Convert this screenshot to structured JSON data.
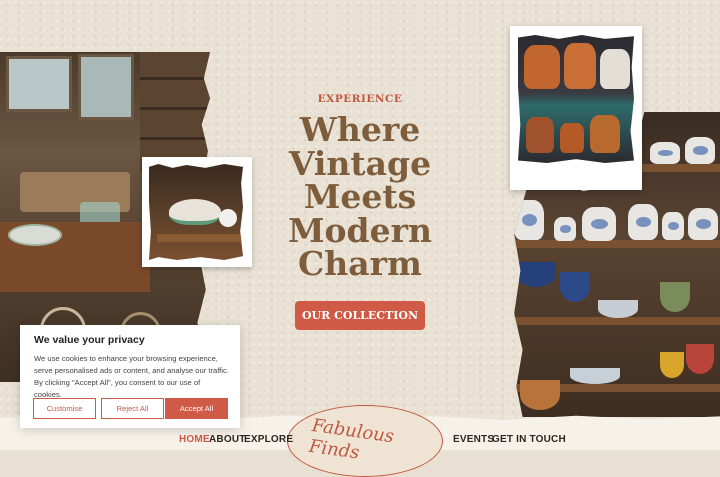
{
  "hero": {
    "eyebrow": "EXPERIENCE",
    "headline_lines": [
      "Where",
      "Vintage",
      "Meets",
      "Modern",
      "Charm"
    ],
    "cta_label": "OUR COLLECTION"
  },
  "nav": {
    "items": [
      {
        "label": "HOME",
        "active": true
      },
      {
        "label": "ABOUT",
        "active": false
      },
      {
        "label": "EXPLORE",
        "active": false
      },
      {
        "label": "EVENTS",
        "active": false
      },
      {
        "label": "GET IN TOUCH",
        "active": false
      }
    ],
    "logo_text": "Fabulous Finds"
  },
  "cookie_banner": {
    "title": "We value your privacy",
    "body": "We use cookies to enhance your browsing experience, serve personalised ads or content, and analyse our traffic. By clicking \"Accept All\", you consent to our use of cookies.",
    "buttons": {
      "customise": "Customise",
      "reject": "Reject All",
      "accept": "Accept All"
    }
  },
  "colors": {
    "accent": "#cf5a45",
    "heading": "#7e5d3c",
    "background": "#e9e2d4"
  }
}
